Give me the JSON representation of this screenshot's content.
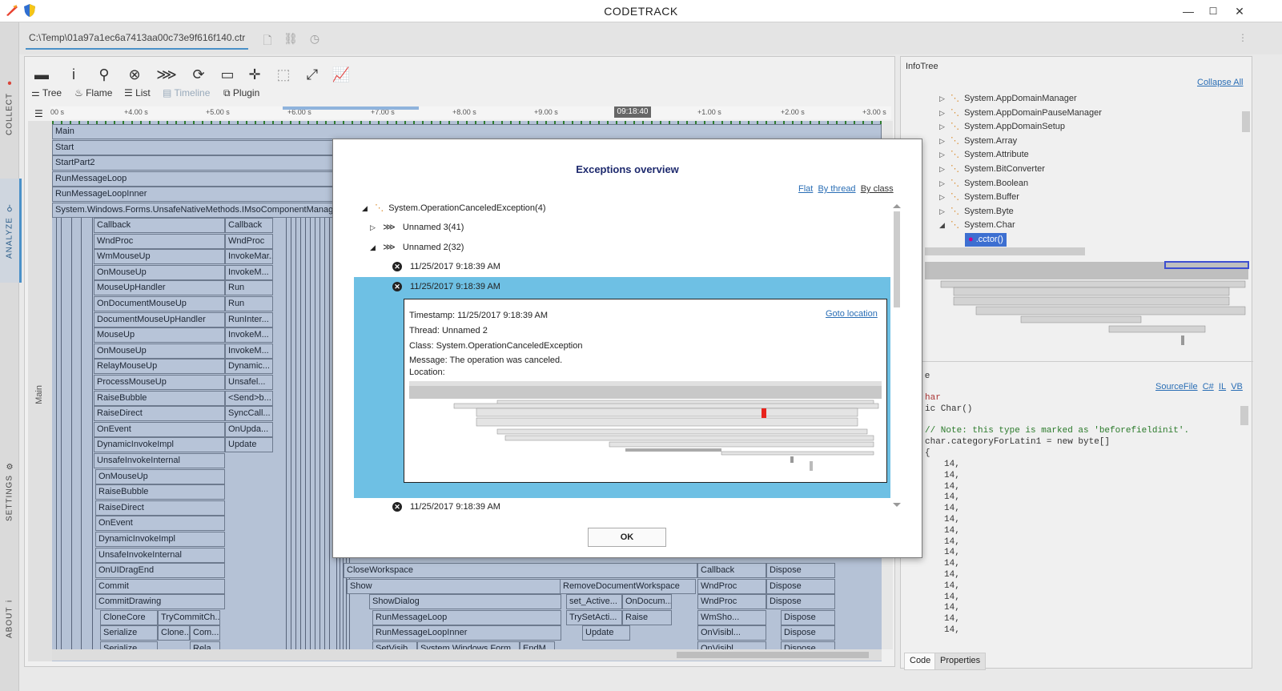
{
  "window": {
    "title": "CODETRACK",
    "minimize": "—",
    "maximize": "☐",
    "close": "✕"
  },
  "leftnav": {
    "collect": "COLLECT",
    "analyze": "ANALYZE",
    "settings": "SETTINGS",
    "about": "ABOUT"
  },
  "doc_tab": {
    "path": "C:\\Temp\\01a97a1ec6a7413aa00c73e9f616f140.ctr"
  },
  "toolbar": {
    "views": [
      {
        "label": "Tree",
        "icon": "tree-icon"
      },
      {
        "label": "Flame",
        "icon": "flame-icon"
      },
      {
        "label": "List",
        "icon": "list-icon"
      },
      {
        "label": "Timeline",
        "icon": "timeline-icon"
      },
      {
        "label": "Plugin",
        "icon": "plugin-icon"
      }
    ]
  },
  "timeline": {
    "ticks": [
      "00 s",
      "+4.00 s",
      "+5.00 s",
      "+6.00 s",
      "+7.00 s",
      "+8.00 s",
      "+9.00 s",
      "+1.00 s",
      "+2.00 s",
      "+3.00 s"
    ],
    "cursor_time": "09:18:40",
    "lane_label": "Main"
  },
  "flame": {
    "col1": [
      "Main",
      "Start",
      "StartPart2",
      "RunMessageLoop",
      "RunMessageLoopInner",
      "System.Windows.Forms.UnsafeNativeMethods.IMsoComponentManag"
    ],
    "col2": [
      "Callback",
      "WndProc",
      "WmMouseUp",
      "OnMouseUp",
      "MouseUpHandler",
      "OnDocumentMouseUp",
      "DocumentMouseUpHandler",
      "MouseUp",
      "OnMouseUp",
      "RelayMouseUp",
      "ProcessMouseUp",
      "RaiseBubble",
      "RaiseDirect",
      "OnEvent",
      "DynamicInvokeImpl",
      "UnsafeInvokeInternal",
      "OnMouseUp",
      "RaiseBubble",
      "RaiseDirect",
      "OnEvent",
      "DynamicInvokeImpl",
      "UnsafeInvokeInternal",
      "OnUIDragEnd",
      "Commit",
      "CommitDrawing"
    ],
    "col3": [
      "Callback",
      "WndProc",
      "InvokeMar...",
      "InvokeM...",
      "Run",
      "Run",
      "RunInter...",
      "InvokeM...",
      "InvokeM...",
      "Dynamic...",
      "Unsafel...",
      "<Send>b...",
      "SyncCall...",
      "OnUpda...",
      "Update"
    ],
    "bottom_left": [
      "CloneCore",
      "TryCommitCh...",
      "Serialize",
      "Clone...",
      "Com...",
      "Serialize",
      "Rela..."
    ],
    "bottom_mid": [
      "CloseWorkspace",
      "Show",
      "ShowDialog",
      "RunMessageLoop",
      "RunMessageLoopInner",
      "SetVisib...",
      "System.Windows.Form...",
      "EndM..."
    ],
    "bottom_mid2": [
      "RemoveDocumentWorkspace",
      "set_Active...",
      "OnDocum...",
      "TrySetActi...",
      "Raise",
      "Update"
    ],
    "bottom_right": [
      "Callback",
      "WndProc",
      "WndProc",
      "WmSho...",
      "OnVisibl...",
      "OnVisibl..."
    ],
    "bottom_right2": [
      "Dispose",
      "Dispose",
      "Dispose",
      "Dispose",
      "Dispose",
      "Dispose"
    ]
  },
  "infotree": {
    "title": "InfoTree",
    "collapse_all": "Collapse All",
    "items": [
      "System.AppDomainManager",
      "System.AppDomainPauseManager",
      "System.AppDomainSetup",
      "System.Array",
      "System.Attribute",
      "System.BitConverter",
      "System.Boolean",
      "System.Buffer",
      "System.Byte",
      "System.Char"
    ],
    "selected_child": ".cctor()"
  },
  "code": {
    "tabs": {
      "source": "SourceFile",
      "csharp": "C#",
      "il": "IL",
      "vb": "VB"
    },
    "lines": [
      "har",
      "ic Char()",
      "",
      "// Note: this type is marked as 'beforefieldinit'.",
      "char.categoryForLatin1 = new byte[]",
      "{"
    ],
    "values": [
      "14,",
      "14,",
      "14,",
      "14,",
      "14,",
      "14,",
      "14,",
      "14,",
      "14,",
      "14,",
      "14,",
      "14,",
      "14,",
      "14,",
      "14,",
      "14,"
    ],
    "bottom_tabs": [
      "Code",
      "Properties"
    ],
    "prefix_e": "e"
  },
  "dialog": {
    "title": "Exceptions overview",
    "filters": [
      "Flat",
      "By thread",
      "By class"
    ],
    "root": "System.OperationCanceledException(4)",
    "threads": [
      "Unnamed 3(41)",
      "Unnamed 2(32)"
    ],
    "entries": [
      "11/25/2017 9:18:39 AM",
      "11/25/2017 9:18:39 AM",
      "11/25/2017 9:18:39 AM"
    ],
    "detail": {
      "timestamp": "Timestamp: 11/25/2017 9:18:39 AM",
      "thread": "Thread: Unnamed 2",
      "class": "Class: System.OperationCanceledException",
      "message": "Message: The operation was canceled.",
      "location": "Location:",
      "goto": "Goto location"
    },
    "ok": "OK"
  }
}
